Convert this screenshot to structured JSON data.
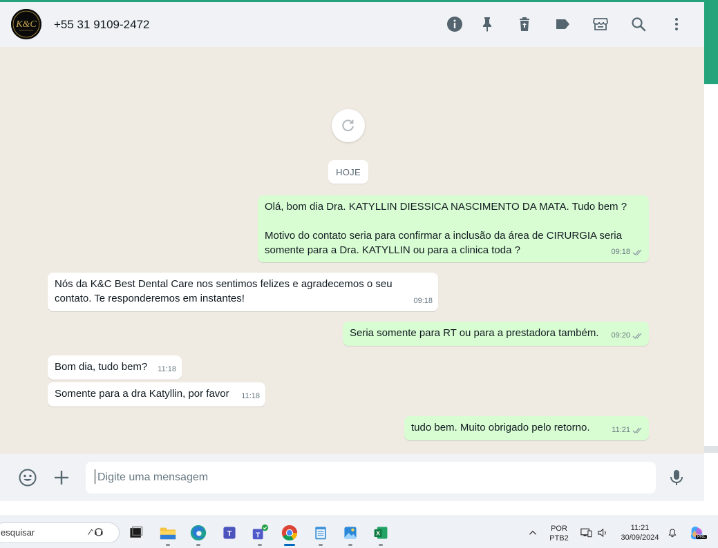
{
  "header": {
    "contact_name": "+55 31 9109-2472",
    "avatar_text": "K&C",
    "icons": [
      "info-icon",
      "pin-icon",
      "delete-icon",
      "label-icon",
      "store-icon",
      "search-icon",
      "menu-icon"
    ]
  },
  "chat": {
    "day_label": "HOJE",
    "messages": [
      {
        "direction": "out",
        "text": "Olá, bom dia Dra. KATYLLIN DIESSICA NASCIMENTO DA MATA. Tudo bem ?\n\nMotivo do contato seria para confirmar a inclusão da área de CIRURGIA seria somente para a Dra. KATYLLIN ou para a clinica toda ?",
        "time": "09:18",
        "read": true
      },
      {
        "direction": "in",
        "text": "Nós da K&C Best Dental Care nos sentimos felizes e agradecemos o seu contato. Te responderemos em instantes!",
        "time": "09:18"
      },
      {
        "direction": "out",
        "text": "Seria somente para RT ou para a prestadora também.",
        "time": "09:20",
        "read": true
      },
      {
        "direction": "in",
        "text": "Bom dia, tudo bem?",
        "time": "11:18"
      },
      {
        "direction": "in",
        "text": "Somente para a dra Katyllin, por favor",
        "time": "11:18"
      },
      {
        "direction": "out",
        "text": "tudo bem. Muito obrigado pelo retorno.",
        "time": "11:21",
        "read": true
      }
    ]
  },
  "composer": {
    "placeholder": "Digite uma mensagem"
  },
  "taskbar": {
    "search_text": "esquisar",
    "language": "POR",
    "keyboard": "PTB2",
    "time": "11:21",
    "date": "30/09/2024",
    "copilot_badge": "PRE"
  },
  "colors": {
    "accent": "#25a37a",
    "outgoing_bubble": "#d9fdd3",
    "incoming_bubble": "#ffffff",
    "read_ticks": "#53bdeb"
  }
}
